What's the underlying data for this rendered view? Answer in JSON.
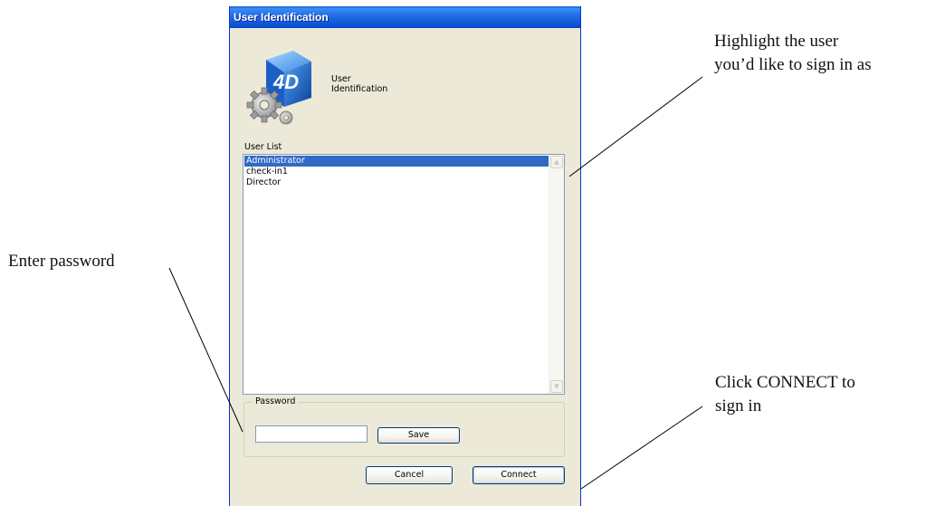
{
  "annotations": {
    "highlight_line1": "Highlight the user",
    "highlight_line2": "you’d like to sign in as",
    "password": "Enter password",
    "connect_line1": "Click CONNECT to",
    "connect_line2": "sign in"
  },
  "dialog": {
    "title": "User Identification",
    "header_line1": "User",
    "header_line2": "Identification",
    "logo_text": "4D",
    "list_label": "User List",
    "users": [
      {
        "name": "Administrator",
        "selected": true
      },
      {
        "name": "check-in1",
        "selected": false
      },
      {
        "name": "Director",
        "selected": false
      }
    ],
    "password_group_label": "Password",
    "password_value": "",
    "save_label": "Save",
    "cancel_label": "Cancel",
    "connect_label": "Connect"
  },
  "colors": {
    "title_bar": "#0A51D4",
    "dialog_bg": "#ECE9D8",
    "selection": "#316AC5"
  }
}
